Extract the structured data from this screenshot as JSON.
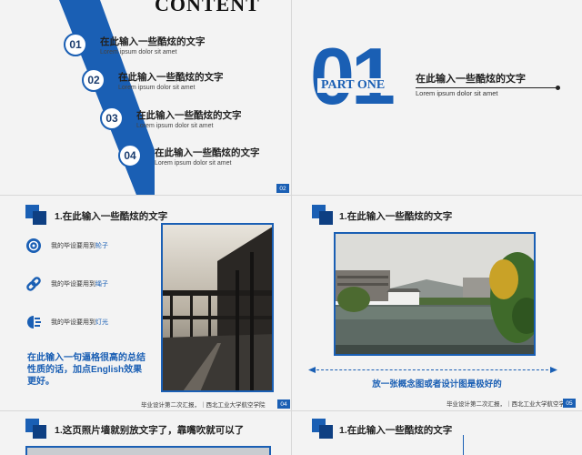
{
  "slide1": {
    "title": "CONTENT",
    "items": [
      {
        "num": "01",
        "cn": "在此输入一些酷炫的文字",
        "en": "Lorem ipsum dolor sit amet"
      },
      {
        "num": "02",
        "cn": "在此输入一些酷炫的文字",
        "en": "Lorem ipsum dolor sit amet"
      },
      {
        "num": "03",
        "cn": "在此输入一些酷炫的文字",
        "en": "Lorem ipsum dolor sit amet"
      },
      {
        "num": "04",
        "cn": "在此输入一些酷炫的文字",
        "en": "Lorem ipsum dolor sit amet"
      }
    ],
    "page": "02"
  },
  "slide2": {
    "big_number": "01",
    "part_label": "PART ONE",
    "cn": "在此输入一些酷炫的文字",
    "en": "Lorem ipsum dolor sit amet"
  },
  "slide3": {
    "title": "1.在此输入一些酷炫的文字",
    "features": [
      {
        "prefix": "我的毕设要用到",
        "highlight": "轮子",
        "icon": "wheel-icon"
      },
      {
        "prefix": "我的毕设要用到",
        "highlight": "绳子",
        "icon": "link-icon"
      },
      {
        "prefix": "我的毕设要用到",
        "highlight": "灯光",
        "icon": "light-icon"
      }
    ],
    "summary": "在此输入一句逼格很高的总结性质的话，加点English效果更好。",
    "footer": "毕业设计第二次汇报，｜西北工业大学航空学院",
    "page": "04"
  },
  "slide4": {
    "title": "1.在此输入一些酷炫的文字",
    "caption": "放一张概念图或者设计图是极好的",
    "footer": "毕业设计第二次汇报，｜西北工业大学航空学院",
    "page": "05"
  },
  "slide5": {
    "title": "1.这页照片墙就别放文字了，靠嘴吹就可以了"
  },
  "slide6": {
    "title": "1.在此输入一些酷炫的文字"
  },
  "colors": {
    "accent": "#1a5fb4",
    "accent_dark": "#0e3f82",
    "background": "#f3f3f3"
  }
}
